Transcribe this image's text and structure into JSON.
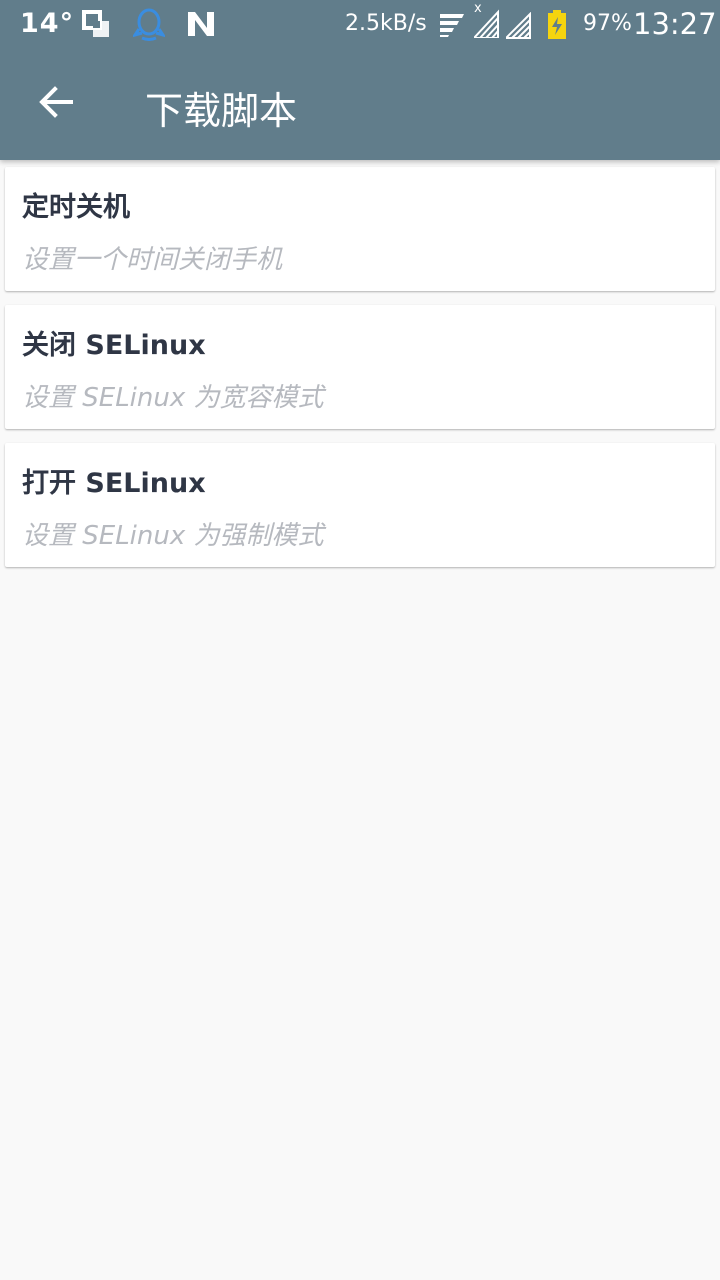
{
  "status_bar": {
    "temperature": "14°",
    "net_speed": "2.5kB/s",
    "battery_percent": "97%",
    "time": "13:27",
    "icons": [
      "screen-mirror-icon",
      "qq-icon",
      "n-app-icon",
      "wifi-icon",
      "signal-x-icon",
      "signal-icon",
      "battery-charging-icon"
    ],
    "signal_x_label": "x",
    "qq_color": "#3a8de0",
    "battery_color": "#f5d40f"
  },
  "app_bar": {
    "back_icon": "arrow-left-icon",
    "title": "下载脚本",
    "background": "#617d8b"
  },
  "scripts": [
    {
      "title": "定时关机",
      "description": "设置一个时间关闭手机"
    },
    {
      "title": "关闭 SELinux",
      "description": "设置 SELinux 为宽容模式"
    },
    {
      "title": "打开 SELinux",
      "description": "设置 SELinux 为强制模式"
    }
  ]
}
